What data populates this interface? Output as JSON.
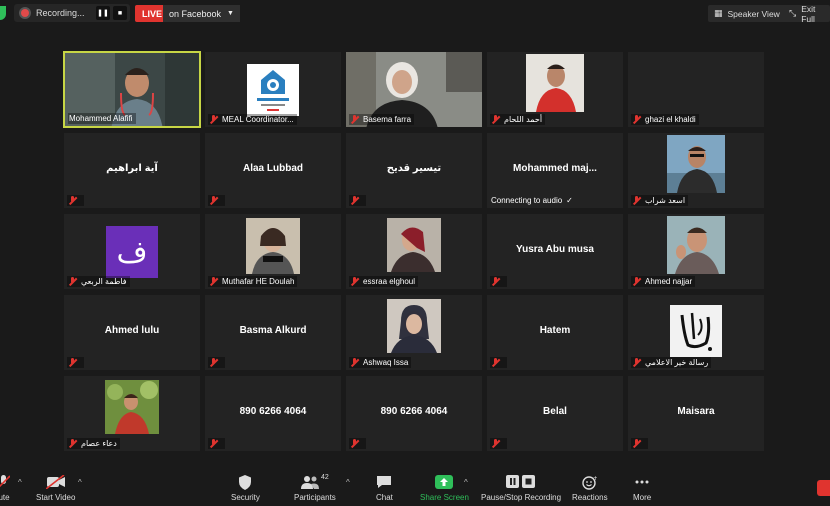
{
  "topbar": {
    "recording_label": "Recording...",
    "pause_glyph": "❚❚",
    "stop_glyph": "■",
    "live_label": "LIVE",
    "live_target": "on Facebook",
    "speaker_view_label": "Speaker View",
    "exit_full_label": "Exit Full"
  },
  "participants": [
    {
      "name": "Mohammed Alafifi",
      "type": "video",
      "active": true,
      "muted": false
    },
    {
      "name": "MEAL Coordinator...",
      "type": "logo",
      "muted": true
    },
    {
      "name": "Basema farra",
      "type": "video",
      "muted": true
    },
    {
      "name": "أحمد اللحام",
      "type": "video",
      "muted": true
    },
    {
      "name": "ghazi el khaldi",
      "type": "text",
      "display": "",
      "muted": true
    },
    {
      "name": "",
      "type": "text",
      "display": "آية ابراهيم",
      "muted": true
    },
    {
      "name": "",
      "type": "text",
      "display": "Alaa Lubbad",
      "muted": true
    },
    {
      "name": "",
      "type": "text",
      "display": "تيسير قديح",
      "muted": true
    },
    {
      "name": "Connecting to audio",
      "type": "text",
      "display": "Mohammed  maj...",
      "muted": false,
      "connecting": true
    },
    {
      "name": "اسعد شراب",
      "type": "photo",
      "muted": true
    },
    {
      "name": "فاطمة الربعي",
      "type": "letter",
      "letter": "ف",
      "muted": true
    },
    {
      "name": "Muthafar HE Doulah",
      "type": "photo",
      "muted": true
    },
    {
      "name": "essraa elghoul",
      "type": "photo",
      "muted": true
    },
    {
      "name": "",
      "type": "text",
      "display": "Yusra Abu musa",
      "muted": true
    },
    {
      "name": "Ahmed najjar",
      "type": "photo",
      "muted": true
    },
    {
      "name": "",
      "type": "text",
      "display": "Ahmed  lulu",
      "muted": true
    },
    {
      "name": "",
      "type": "text",
      "display": "Basma Alkurd",
      "muted": true
    },
    {
      "name": "Ashwaq Issa",
      "type": "photo",
      "muted": true
    },
    {
      "name": "",
      "type": "text",
      "display": "Hatem",
      "muted": true
    },
    {
      "name": "رسالة خير الاعلامي",
      "type": "logo2",
      "muted": true
    },
    {
      "name": "دعاء عصام",
      "type": "photo",
      "muted": true
    },
    {
      "name": "",
      "type": "text",
      "display": "890 6266 4064",
      "muted": true
    },
    {
      "name": "",
      "type": "text",
      "display": "890 6266 4064",
      "muted": true
    },
    {
      "name": "",
      "type": "text",
      "display": "Belal",
      "muted": true
    },
    {
      "name": "",
      "type": "text",
      "display": "Maisara",
      "muted": true
    }
  ],
  "toolbar": {
    "mute_label": "ute",
    "start_video_label": "Start Video",
    "security_label": "Security",
    "participants_label": "Participants",
    "participants_count": "42",
    "chat_label": "Chat",
    "share_screen_label": "Share Screen",
    "record_label": "Pause/Stop Recording",
    "reactions_label": "Reactions",
    "more_label": "More",
    "caret": "^"
  },
  "colors": {
    "background": "#1a1a1a",
    "tile": "#232323",
    "active_border": "#c7d645",
    "live_red": "#e0342f",
    "share_green": "#2fbf5a"
  }
}
